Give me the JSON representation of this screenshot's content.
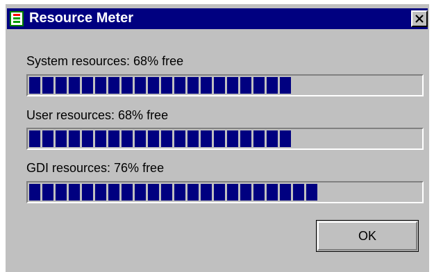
{
  "window": {
    "title": "Resource Meter",
    "icon": "resource-meter-app-icon",
    "close_icon": "close-x-icon"
  },
  "meters": [
    {
      "label": "System resources: 68% free",
      "percent_free": 68
    },
    {
      "label": "User resources: 68% free",
      "percent_free": 68
    },
    {
      "label": "GDI resources: 76% free",
      "percent_free": 76
    }
  ],
  "buttons": {
    "ok_label": "OK"
  },
  "colors": {
    "title_bar": "#000080",
    "meter_fill": "#000080",
    "face": "#c0c0c0"
  }
}
